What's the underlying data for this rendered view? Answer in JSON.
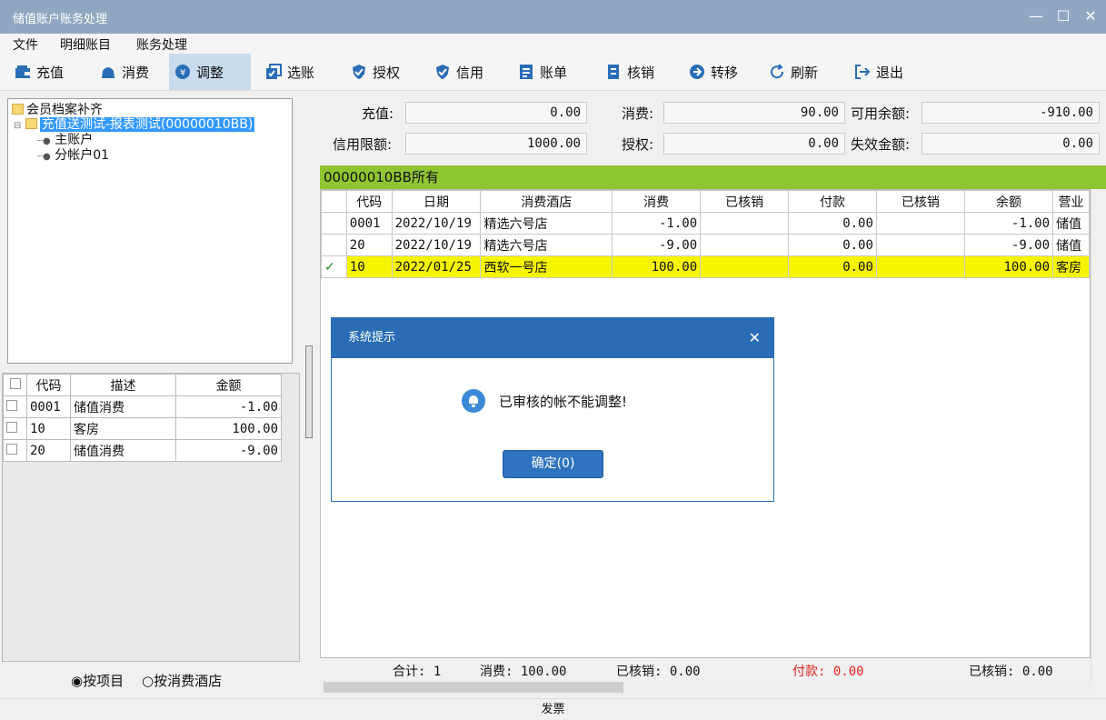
{
  "window": {
    "title": "储值账户账务处理"
  },
  "menu": [
    "文件",
    "明细账目",
    "账务处理"
  ],
  "toolbar": [
    {
      "label": "充值",
      "icon": "wallet-icon"
    },
    {
      "label": "消费",
      "icon": "bag-icon"
    },
    {
      "label": "调整",
      "icon": "adjust-icon",
      "active": true
    },
    {
      "label": "选账",
      "icon": "select-account-icon"
    },
    {
      "label": "授权",
      "icon": "shield-check-icon"
    },
    {
      "label": "信用",
      "icon": "shield-icon"
    },
    {
      "label": "账单",
      "icon": "bill-icon"
    },
    {
      "label": "核销",
      "icon": "writeoff-icon"
    },
    {
      "label": "转移",
      "icon": "arrow-right-icon"
    },
    {
      "label": "刷新",
      "icon": "refresh-icon"
    },
    {
      "label": "退出",
      "icon": "exit-icon"
    }
  ],
  "tree": {
    "root": "会员档案补齐",
    "member": "充值送测试-报表测试(00000010BB)",
    "accounts": [
      "主账户",
      "分帐户01"
    ]
  },
  "left_grid": {
    "headers": [
      "代码",
      "描述",
      "金额"
    ],
    "rows": [
      {
        "code": "0001",
        "desc": "储值消费",
        "amount": "-1.00"
      },
      {
        "code": "10",
        "desc": "客房",
        "amount": "100.00"
      },
      {
        "code": "20",
        "desc": "储值消费",
        "amount": "-9.00"
      }
    ]
  },
  "radios": {
    "by_item": "按项目",
    "by_hotel": "按消费酒店",
    "selected": "by_item"
  },
  "summary": {
    "recharge_label": "充值:",
    "recharge": "0.00",
    "consume_label": "消费:",
    "consume": "90.00",
    "available_label": "可用余额:",
    "available": "-910.00",
    "credit_label": "信用限额:",
    "credit": "1000.00",
    "auth_label": "授权:",
    "auth": "0.00",
    "expired_label": "失效金额:",
    "expired": "0.00"
  },
  "account_header": "00000010BB所有",
  "right_grid": {
    "headers": [
      "代码",
      "日期",
      "消费酒店",
      "消费",
      "已核销",
      "付款",
      "已核销",
      "余额",
      "营业"
    ],
    "rows": [
      {
        "code": "0001",
        "date": "2022/10/19",
        "hotel": "精选六号店",
        "consume": "-1.00",
        "wo1": "",
        "pay": "0.00",
        "wo2": "",
        "balance": "-1.00",
        "biz": "储值",
        "checked": false
      },
      {
        "code": "20",
        "date": "2022/10/19",
        "hotel": "精选六号店",
        "consume": "-9.00",
        "wo1": "",
        "pay": "0.00",
        "wo2": "",
        "balance": "-9.00",
        "biz": "储值",
        "checked": false
      },
      {
        "code": "10",
        "date": "2022/01/25",
        "hotel": "西软一号店",
        "consume": "100.00",
        "wo1": "",
        "pay": "0.00",
        "wo2": "",
        "balance": "100.00",
        "biz": "客房",
        "checked": true
      }
    ]
  },
  "totals": {
    "count": "合计: 1",
    "consume": "消费: 100.00",
    "wo1": "已核销: 0.00",
    "pay": "付款: 0.00",
    "wo2": "已核销: 0.00",
    "pay_color": "#e02020"
  },
  "status": "发票",
  "dialog": {
    "title": "系统提示",
    "message": "已审核的帐不能调整!",
    "ok": "确定(0)"
  }
}
